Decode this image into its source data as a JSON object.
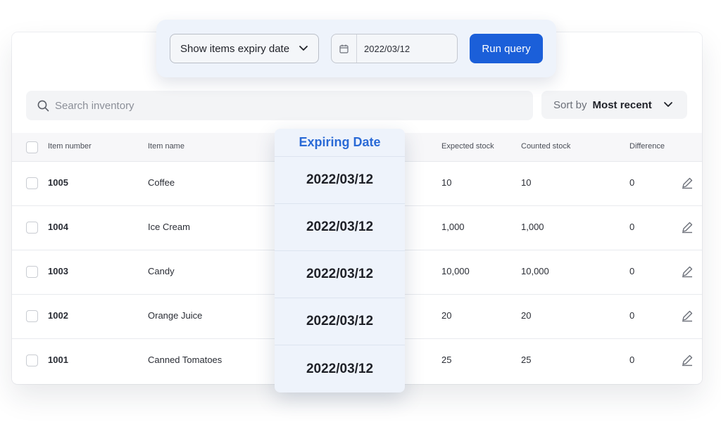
{
  "query": {
    "filter_select": "Show items expiry date",
    "date_value": "2022/03/12",
    "run_label": "Run query"
  },
  "search": {
    "placeholder": "Search inventory"
  },
  "sort": {
    "prefix": "Sort by",
    "value": "Most recent"
  },
  "table": {
    "headers": {
      "item_number": "Item number",
      "item_name": "Item name",
      "expected": "Expected stock",
      "counted": "Counted stock",
      "difference": "Difference"
    },
    "rows": [
      {
        "number": "1005",
        "name": "Coffee",
        "expected": "10",
        "counted": "10",
        "difference": "0",
        "expiry": "2022/03/12"
      },
      {
        "number": "1004",
        "name": "Ice Cream",
        "expected": "1,000",
        "counted": "1,000",
        "difference": "0",
        "expiry": "2022/03/12"
      },
      {
        "number": "1003",
        "name": "Candy",
        "expected": "10,000",
        "counted": "10,000",
        "difference": "0",
        "expiry": "2022/03/12"
      },
      {
        "number": "1002",
        "name": "Orange Juice",
        "expected": "20",
        "counted": "20",
        "difference": "0",
        "expiry": "2022/03/12"
      },
      {
        "number": "1001",
        "name": "Canned Tomatoes",
        "expected": "25",
        "counted": "25",
        "difference": "0",
        "expiry": "2022/03/12"
      }
    ]
  },
  "expiry_column": {
    "header": "Expiring Date"
  },
  "colors": {
    "accent": "#1b5fd9",
    "expiry_header": "#2a6ad6",
    "panel_bg": "#eef3fb"
  }
}
